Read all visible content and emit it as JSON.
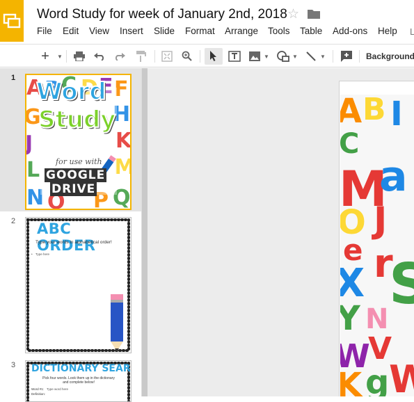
{
  "app": {
    "icon": "slides-app-icon"
  },
  "document": {
    "title": "Word Study for week of January 2nd, 2018"
  },
  "menu": {
    "items": [
      "File",
      "Edit",
      "View",
      "Insert",
      "Slide",
      "Format",
      "Arrange",
      "Tools",
      "Table",
      "Add-ons",
      "Help"
    ],
    "cutoff": "L"
  },
  "toolbar": {
    "background_label": "Background...",
    "icons": [
      "add-icon",
      "dropdown-arrow-icon",
      "print-icon",
      "undo-icon",
      "redo-icon",
      "paint-format-icon",
      "zoom-fit-icon",
      "zoom-icon",
      "select-cursor-icon",
      "text-box-icon",
      "image-icon",
      "shape-icon",
      "line-icon",
      "comment-add-icon"
    ]
  },
  "slides": [
    {
      "number": "1",
      "title_line1": "Word",
      "title_line2": "Study",
      "subtitle": "for use with",
      "brand_line1": "GOOGLE",
      "brand_line2": "DRIVE"
    },
    {
      "number": "2",
      "title": "ABC ORDER",
      "instruction": "Type your words in alphabetical order!",
      "bullet": "Type here"
    },
    {
      "number": "3",
      "title": "DICTIONARY SEARCH",
      "instruction": "Pick four words. Look them up in the dictionary and complete below!",
      "row_label1": "Word #1:",
      "row_label2": "Definition:",
      "row_value": "Type word here"
    }
  ],
  "colors": {
    "accent": "#f4b400",
    "slide_blue": "#2fa4e0",
    "title_green": "#7cd12a"
  }
}
